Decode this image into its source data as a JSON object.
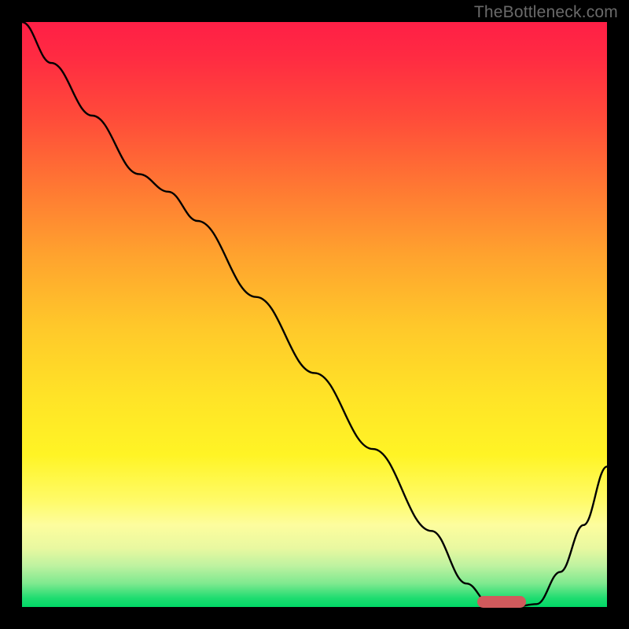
{
  "watermark": "TheBottleneck.com",
  "chart_data": {
    "type": "line",
    "title": "",
    "xlabel": "",
    "ylabel": "",
    "xlim": [
      0,
      100
    ],
    "ylim": [
      0,
      100
    ],
    "x": [
      0,
      5,
      12,
      20,
      25,
      30,
      40,
      50,
      60,
      70,
      76,
      80,
      84,
      88,
      92,
      96,
      100
    ],
    "values": [
      100,
      93,
      84,
      74,
      71,
      66,
      53,
      40,
      27,
      13,
      4,
      0.5,
      0,
      0.5,
      6,
      14,
      24
    ],
    "gradient_colors": {
      "top": "#ff1f46",
      "mid": "#ffe327",
      "bottom": "#00d866"
    },
    "minimum_marker": {
      "x": 82,
      "color": "#d05a5c"
    },
    "annotations": []
  }
}
